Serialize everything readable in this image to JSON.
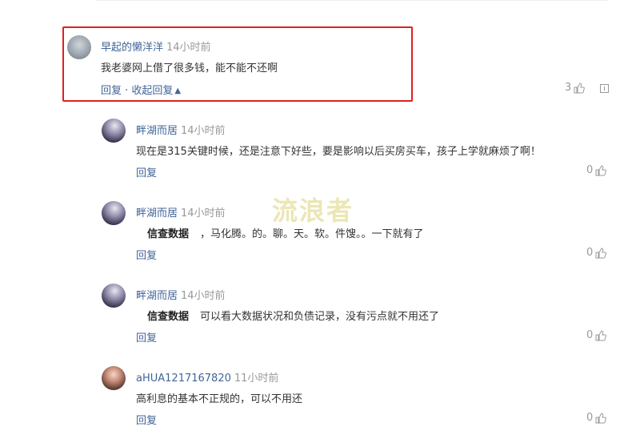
{
  "comments": [
    {
      "author": "早起的懒洋洋",
      "time": "14小时前",
      "text": "我老婆网上借了很多钱，能不能不还啊",
      "reply": "回复 · 收起回复",
      "likes": "3"
    },
    {
      "author": "畔湖而居",
      "time": "14小时前",
      "text": "现在是315关键时候，还是注意下好些，要是影响以后买房买车，孩子上学就麻烦了啊！",
      "reply": "回复",
      "likes": "0"
    },
    {
      "author": "畔湖而居",
      "time": "14小时前",
      "bold": "信查数据",
      "text": "，马化腾。的。聊。天。软。件馊。。一下就有了",
      "reply": "回复",
      "likes": "0"
    },
    {
      "author": "畔湖而居",
      "time": "14小时前",
      "bold": "信查数据",
      "text": "可以看大数据状况和负债记录，没有污点就不用还了",
      "reply": "回复",
      "likes": "0"
    },
    {
      "author": "aHUA1217167820",
      "time": "11小时前",
      "text": "高利息的基本不正规的，可以不用还",
      "reply": "回复",
      "likes": "0"
    }
  ],
  "watermark": "流浪者",
  "icons": {
    "like": "thumbs-up-icon",
    "report": "report-icon",
    "collapse": "chevron-up-icon"
  }
}
